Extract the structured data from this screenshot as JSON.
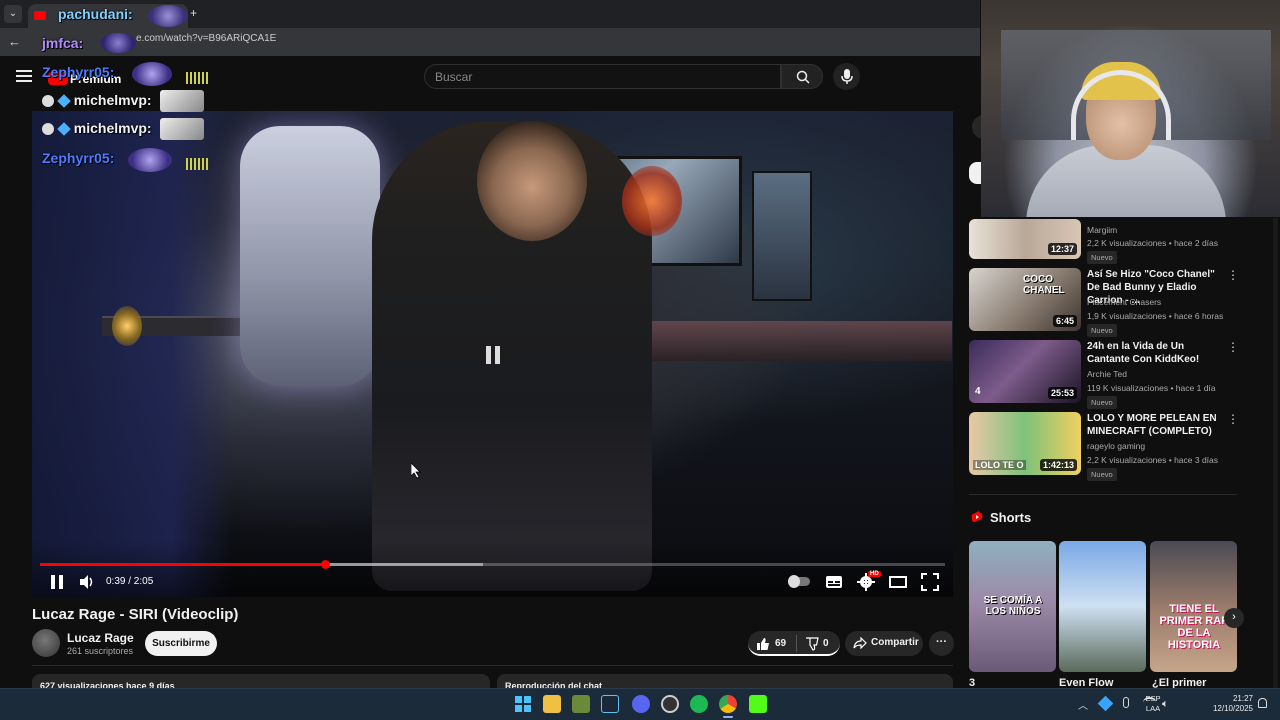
{
  "browser": {
    "tab_title": "pachudani:",
    "url": "e.com/watch?v=B96ARiQCA1E",
    "back_icon": "arrow-left-icon",
    "new_tab_symbol": "+"
  },
  "header": {
    "premium_label": "Premium",
    "search_placeholder": "Buscar"
  },
  "chat_overlay": [
    {
      "user": "pachudani:",
      "color": "#7fd0ff"
    },
    {
      "user": "jmfca:",
      "color": "#b08cff"
    },
    {
      "user": "Zephyrr05:",
      "color": "#4f7bff"
    },
    {
      "user": "michelmvp:",
      "color": "#f1f1f1"
    },
    {
      "user": "michelmvp:",
      "color": "#f1f1f1"
    },
    {
      "user": "Zephyrr05:",
      "color": "#4f7bff"
    }
  ],
  "player": {
    "time": "0:39 / 2:05",
    "progress_fraction": 0.315,
    "buffered_fraction": 0.49,
    "settings_badge": "HD"
  },
  "video": {
    "title": "Lucaz Rage - SIRI (Videoclip)",
    "channel": "Lucaz Rage",
    "subscribers": "261 suscriptores",
    "subscribe_label": "Suscribirme",
    "likes": "69",
    "dislikes": "0",
    "share_label": "Compartir",
    "more_label": "···",
    "views_date": "627 visualizaciones  hace 9 días",
    "chat_replay": "Reproducción del chat"
  },
  "recommendations": [
    {
      "title": "",
      "channel": "Margiim",
      "meta": "2,2 K visualizaciones • hace 2 días",
      "badge": "Nuevo",
      "duration": "12:37"
    },
    {
      "title": "Así Se Hizo \"Coco Chanel\" De Bad Bunny y Eladio Carrion - ...",
      "channel": "Placement Chasers",
      "meta": "1,9 K visualizaciones • hace 6 horas",
      "badge": "Nuevo",
      "duration": "6:45",
      "thumb_text": "COCO CHANEL"
    },
    {
      "title": "24h en la Vida de Un Cantante Con KiddKeo!",
      "channel": "Archie Ted",
      "meta": "119 K visualizaciones • hace 1 día",
      "badge": "Nuevo",
      "duration": "25:53",
      "thumb_text": "4"
    },
    {
      "title": "LOLO Y MORE PELEAN EN MINECRAFT (COMPLETO)",
      "channel": "rageylo gaming",
      "meta": "2,2 K visualizaciones • hace 3 días",
      "badge": "Nuevo",
      "duration": "1:42:13",
      "thumb_text": "LOLO TE O"
    }
  ],
  "shorts": {
    "heading": "Shorts",
    "items": [
      {
        "label": "3",
        "thumb_text": "SE COMÍA A LOS NIÑOS"
      },
      {
        "label": "Even Flow",
        "thumb_text": ""
      },
      {
        "label": "¿El primer",
        "thumb_text": "TIENE EL PRIMER RAP DE LA HISTORIA"
      }
    ]
  },
  "taskbar": {
    "lang": "ESP",
    "lang2": "LAA",
    "time": "21:27",
    "date": "12/10/2025"
  }
}
